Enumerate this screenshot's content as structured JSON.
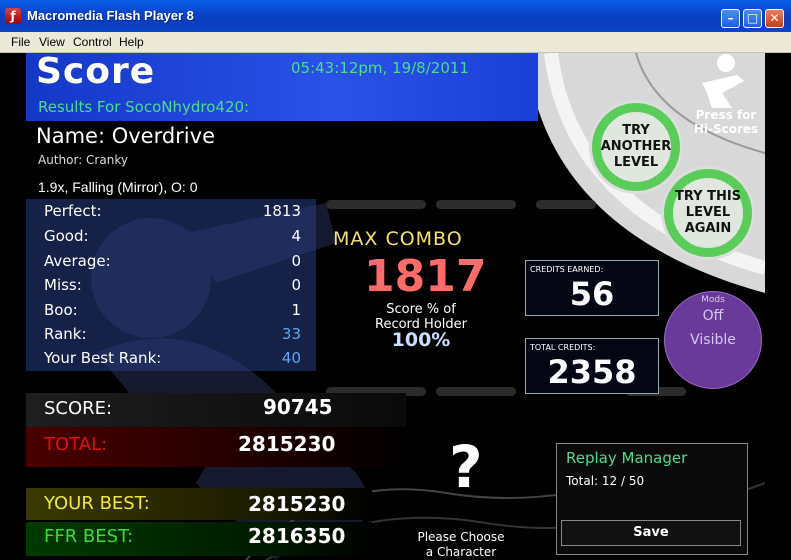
{
  "window": {
    "title": "Macromedia Flash Player 8"
  },
  "menu": [
    "File",
    "View",
    "Control",
    "Help"
  ],
  "header": {
    "title": "Score",
    "datetime": "05:43:12pm, 19/8/2011",
    "results_for": "Results For SocoNhydro420:"
  },
  "song": {
    "name": "Name: Overdrive",
    "author": "Author: Cranky",
    "settings": "1.9x, Falling (Mirror), O: 0"
  },
  "stats": [
    {
      "label": "Perfect:",
      "value": "1813"
    },
    {
      "label": "Good:",
      "value": "4"
    },
    {
      "label": "Average:",
      "value": "0"
    },
    {
      "label": "Miss:",
      "value": "0"
    },
    {
      "label": "Boo:",
      "value": "1"
    },
    {
      "label": "Rank:",
      "value": "33"
    },
    {
      "label": "Your Best Rank:",
      "value": "40"
    }
  ],
  "combo": {
    "label": "MAX COMBO",
    "value": "1817",
    "pct_label_1": "Score % of",
    "pct_label_2": "Record Holder",
    "pct_value": "100%"
  },
  "credits": {
    "earned_label": "CREDITS EARNED:",
    "earned_value": "56",
    "total_label": "TOTAL CREDITS:",
    "total_value": "2358"
  },
  "buttons": {
    "hi_scores_1": "Press for",
    "hi_scores_2": "Hi-Scores",
    "try_another": "TRY ANOTHER LEVEL",
    "try_again": "TRY THIS LEVEL AGAIN"
  },
  "mods": {
    "label": "Mods",
    "value_1": "Off",
    "value_2": "Visible"
  },
  "scores": {
    "score_label": "SCORE:",
    "score_value": "90745",
    "total_label": "TOTAL:",
    "total_value": "2815230",
    "your_best_label": "YOUR BEST:",
    "your_best_value": "2815230",
    "ffr_best_label": "FFR BEST:",
    "ffr_best_value": "2816350"
  },
  "character": {
    "symbol": "?",
    "prompt_1": "Please Choose",
    "prompt_2": "a Character"
  },
  "replay": {
    "title": "Replay Manager",
    "total": "Total: 12 / 50",
    "save_label": "Save"
  },
  "colors": {
    "header_blue": "#1a3fd8",
    "accent_green": "#4ade8a",
    "combo_yellow": "#f5e070",
    "combo_red": "#ff6060",
    "total_red": "#e01010",
    "best_yellow": "#f0e838",
    "ffr_green": "#30e030",
    "mods_purple": "#6a3a9a"
  }
}
